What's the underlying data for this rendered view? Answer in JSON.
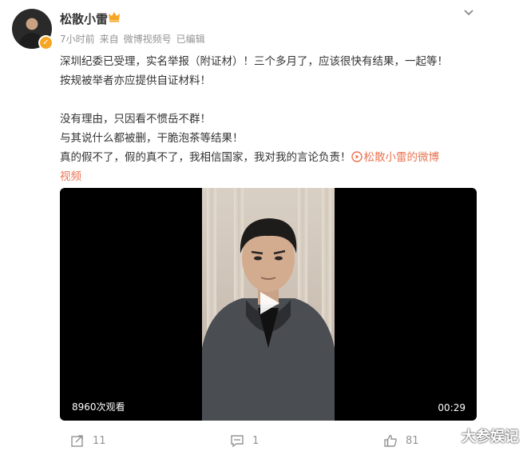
{
  "user": {
    "name": "松散小雷",
    "crown_icon": "crown-icon",
    "verified_icon": "verified-badge-icon",
    "accent_color": "#f5a623"
  },
  "meta": {
    "time": "7小时前",
    "source_prefix": "来自",
    "source": "微博视频号",
    "edited": "已编辑"
  },
  "post": {
    "line1": "深圳纪委已受理，实名举报（附证材）！三个多月了，应该很快有结果，一起等！",
    "line2": "按规被举者亦应提供自证材料！",
    "line3": "没有理由，只因看不惯岳不群！",
    "line4": "与其说什么都被删，干脆泡茶等结果！",
    "line5": "真的假不了，假的真不了，我相信国家，我对我的言论负责！",
    "video_link": "松散小雷的微博",
    "video_link_cont": "视频",
    "link_color": "#eb7350"
  },
  "video": {
    "views": "8960次观看",
    "duration": "00:29",
    "play_icon": "play-icon"
  },
  "actions": {
    "repost_count": "11",
    "comment_count": "1",
    "like_count": "81"
  },
  "watermark": "大参娱记"
}
